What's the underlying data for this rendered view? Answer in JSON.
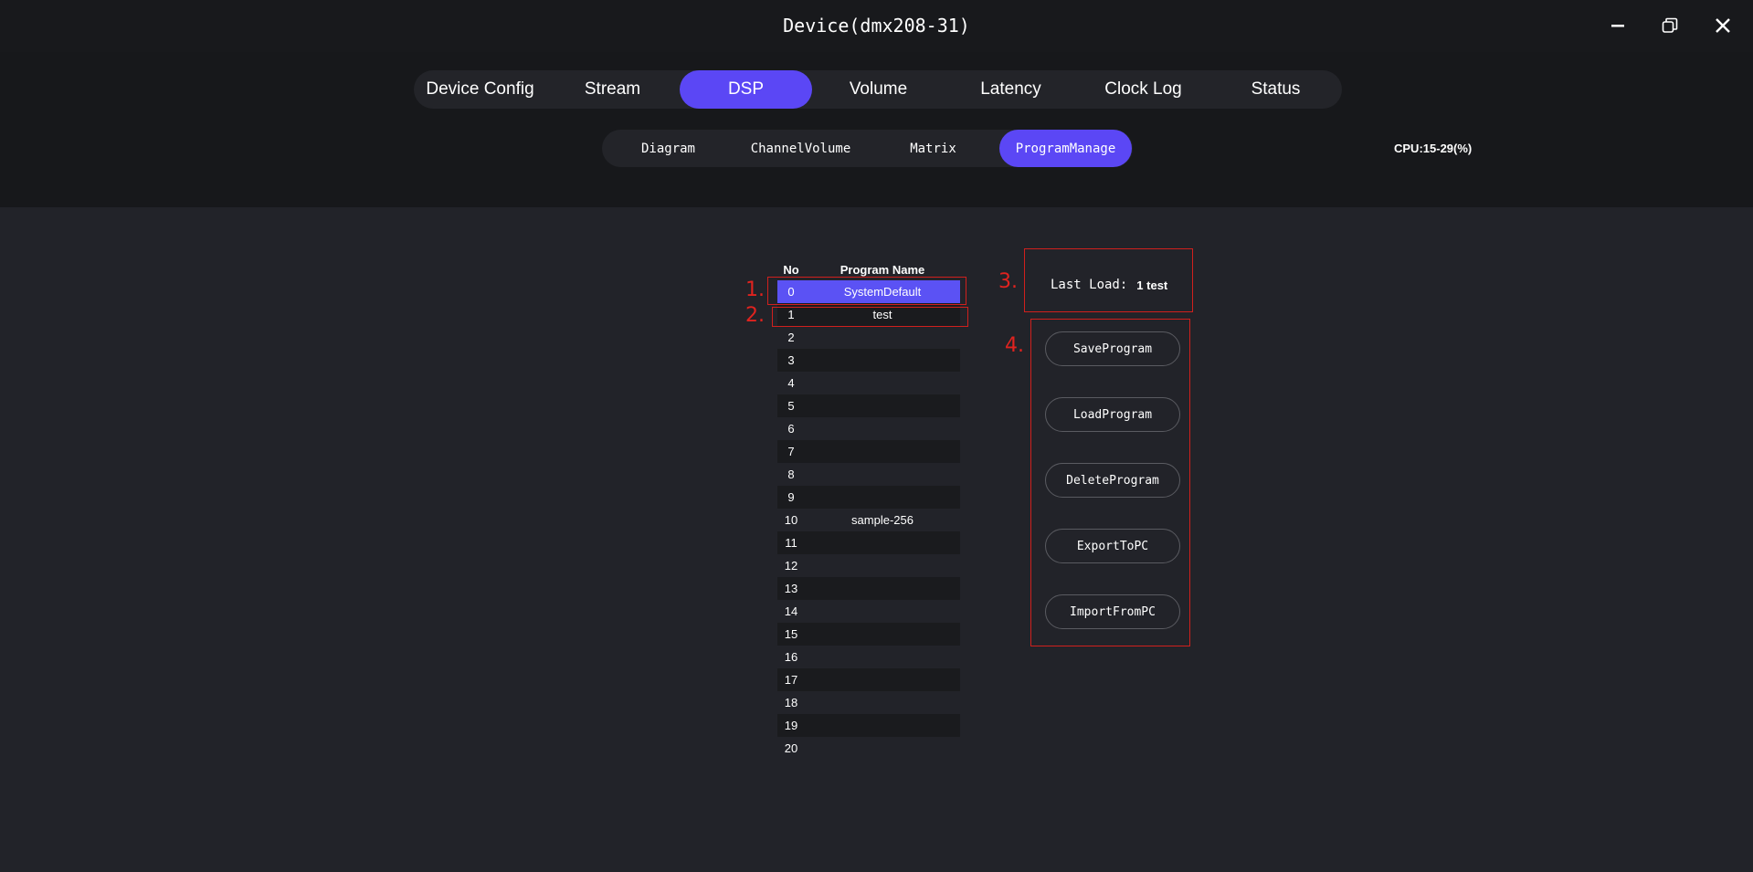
{
  "window": {
    "title": "Device(dmx208-31)"
  },
  "main_tabs": [
    {
      "label": "Device Config"
    },
    {
      "label": "Stream"
    },
    {
      "label": "DSP"
    },
    {
      "label": "Volume"
    },
    {
      "label": "Latency"
    },
    {
      "label": "Clock Log"
    },
    {
      "label": "Status"
    }
  ],
  "main_tabs_active": "DSP",
  "sub_tabs": [
    {
      "label": "Diagram"
    },
    {
      "label": "ChannelVolume"
    },
    {
      "label": "Matrix"
    },
    {
      "label": "ProgramManage"
    }
  ],
  "sub_tabs_active": "ProgramManage",
  "cpu": "CPU:15-29(%)",
  "program_table": {
    "headers": {
      "no": "No",
      "name": "Program Name"
    },
    "rows": [
      {
        "no": "0",
        "name": "SystemDefault"
      },
      {
        "no": "1",
        "name": "test"
      },
      {
        "no": "2",
        "name": ""
      },
      {
        "no": "3",
        "name": ""
      },
      {
        "no": "4",
        "name": ""
      },
      {
        "no": "5",
        "name": ""
      },
      {
        "no": "6",
        "name": ""
      },
      {
        "no": "7",
        "name": ""
      },
      {
        "no": "8",
        "name": ""
      },
      {
        "no": "9",
        "name": ""
      },
      {
        "no": "10",
        "name": "sample-256"
      },
      {
        "no": "11",
        "name": ""
      },
      {
        "no": "12",
        "name": ""
      },
      {
        "no": "13",
        "name": ""
      },
      {
        "no": "14",
        "name": ""
      },
      {
        "no": "15",
        "name": ""
      },
      {
        "no": "16",
        "name": ""
      },
      {
        "no": "17",
        "name": ""
      },
      {
        "no": "18",
        "name": ""
      },
      {
        "no": "19",
        "name": ""
      },
      {
        "no": "20",
        "name": ""
      }
    ],
    "selected_no": "0"
  },
  "last_load": {
    "label": "Last Load:",
    "value": "1 test"
  },
  "actions": {
    "save": "SaveProgram",
    "load": "LoadProgram",
    "delete": "DeleteProgram",
    "export": "ExportToPC",
    "import": "ImportFromPC"
  },
  "annotations": {
    "a1": "1.",
    "a2": "2.",
    "a3": "3.",
    "a4": "4."
  },
  "colors": {
    "accent": "#5b47f5",
    "annotation": "#d0201d",
    "background": "#222329"
  }
}
